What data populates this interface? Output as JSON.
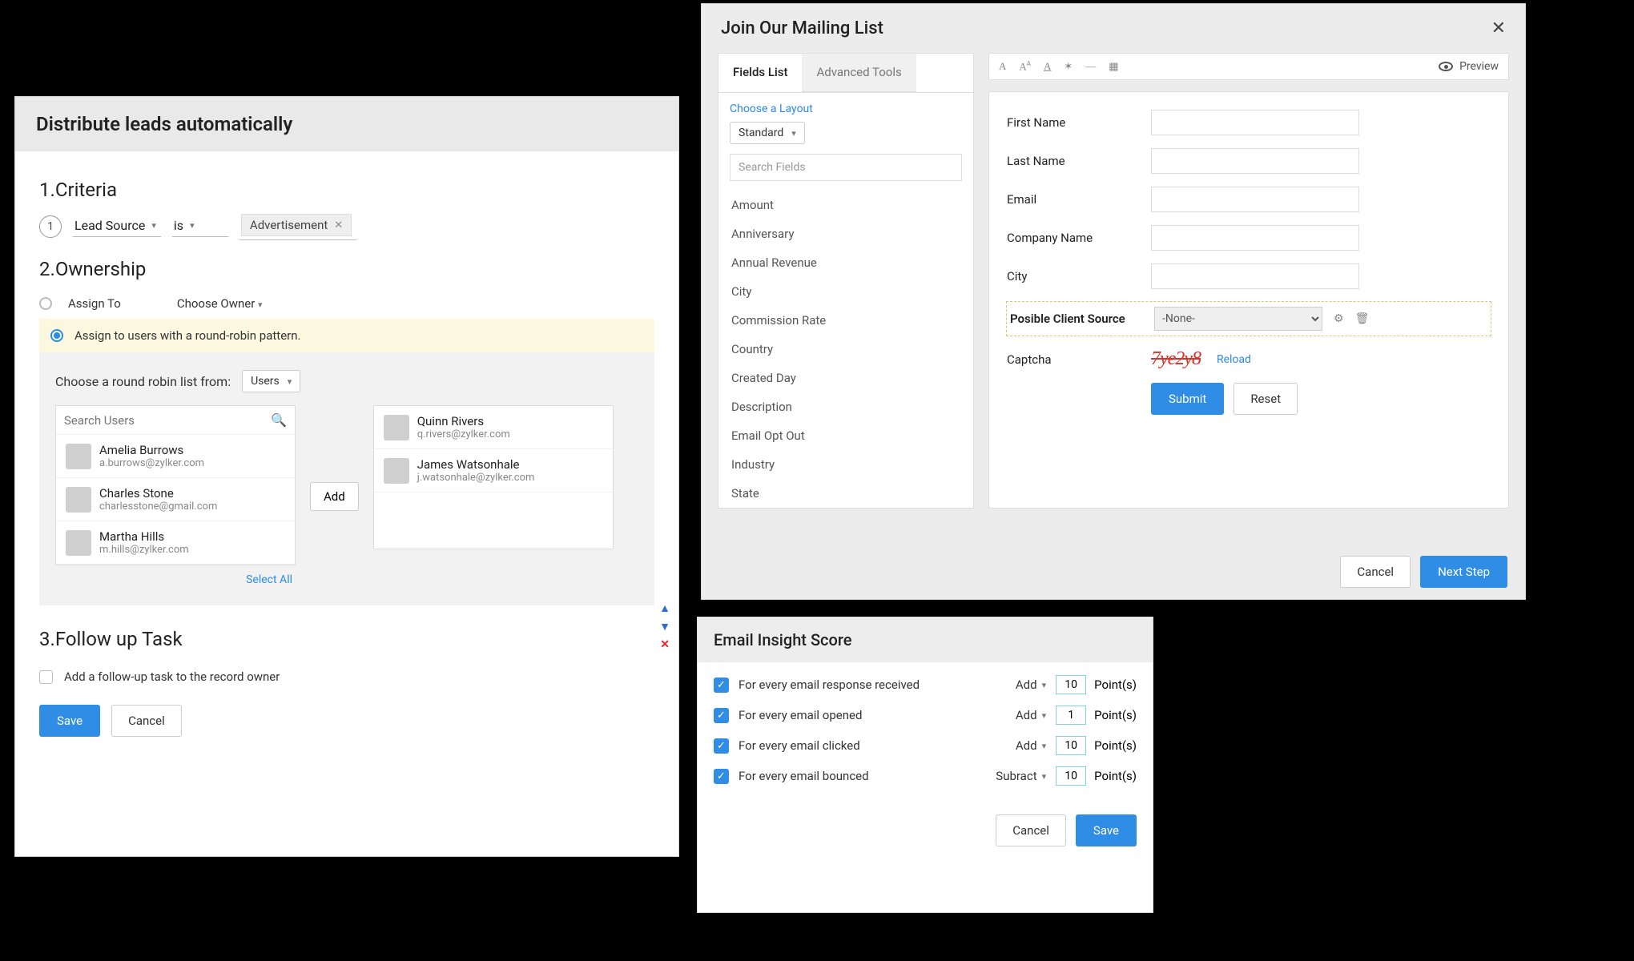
{
  "leads": {
    "title": "Distribute leads automatically",
    "criteria": {
      "heading": "1.Criteria",
      "num": "1",
      "field": "Lead Source",
      "op": "is",
      "value": "Advertisement"
    },
    "ownership": {
      "heading": "2.Ownership",
      "assignTo": "Assign To",
      "chooseOwner": "Choose Owner",
      "roundRobinLabel": "Assign to users with a round-robin pattern.",
      "chooseRR": "Choose a round robin list from:",
      "rrSource": "Users",
      "searchPh": "Search Users",
      "addBtn": "Add",
      "selectAll": "Select All",
      "leftUsers": [
        {
          "name": "Amelia Burrows",
          "email": "a.burrows@zylker.com"
        },
        {
          "name": "Charles Stone",
          "email": "charlesstone@gmail.com"
        },
        {
          "name": "Martha Hills",
          "email": "m.hills@zylker.com"
        }
      ],
      "rightUsers": [
        {
          "name": "Quinn Rivers",
          "email": "q.rivers@zylker.com"
        },
        {
          "name": "James Watsonhale",
          "email": "j.watsonhale@zylker.com"
        }
      ]
    },
    "followUp": {
      "heading": "3.Follow up Task",
      "label": "Add a follow-up task to the record owner"
    },
    "save": "Save",
    "cancel": "Cancel"
  },
  "mail": {
    "title": "Join Our Mailing List",
    "tabs": [
      "Fields List",
      "Advanced Tools"
    ],
    "chooseLayout": "Choose a Layout",
    "layout": "Standard",
    "searchPh": "Search Fields",
    "fields": [
      "Amount",
      "Anniversary",
      "Annual Revenue",
      "City",
      "Commission Rate",
      "Country",
      "Created Day",
      "Description",
      "Email Opt Out",
      "Industry",
      "State"
    ],
    "preview": "Preview",
    "formLabels": {
      "first": "First Name",
      "last": "Last Name",
      "email": "Email",
      "company": "Company Name",
      "city": "City",
      "source": "Posible Client Source",
      "captcha": "Captcha"
    },
    "sourceVal": "-None-",
    "captchaTxt": "7ye2y8",
    "reload": "Reload",
    "submit": "Submit",
    "reset": "Reset",
    "footCancel": "Cancel",
    "footNext": "Next Step"
  },
  "insight": {
    "title": "Email Insight Score",
    "rows": [
      {
        "txt": "For every email response received",
        "op": "Add",
        "val": "10"
      },
      {
        "txt": "For every email opened",
        "op": "Add",
        "val": "1"
      },
      {
        "txt": "For every email clicked",
        "op": "Add",
        "val": "10"
      },
      {
        "txt": "For every email bounced",
        "op": "Subract",
        "val": "10"
      }
    ],
    "points": "Point(s)",
    "cancel": "Cancel",
    "save": "Save"
  }
}
